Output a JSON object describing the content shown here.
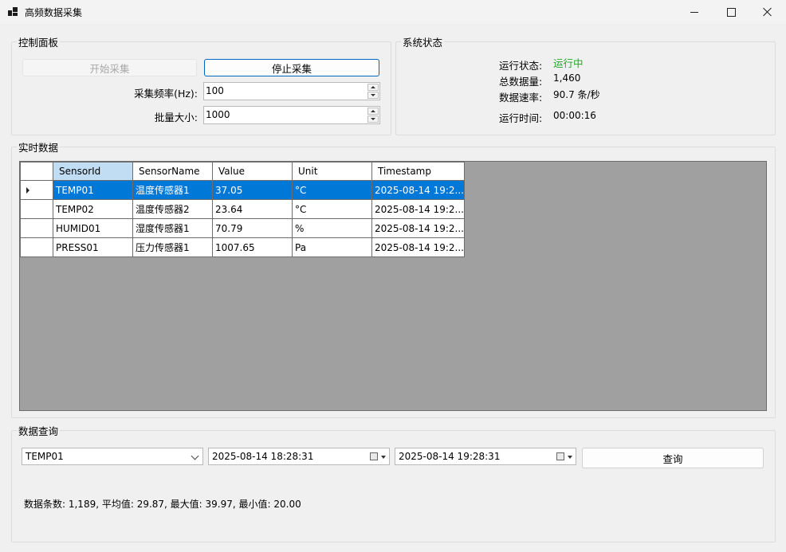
{
  "window": {
    "title": "高频数据采集"
  },
  "control": {
    "legend": "控制面板",
    "start_label": "开始采集",
    "stop_label": "停止采集",
    "freq_label": "采集频率(Hz):",
    "freq_value": "100",
    "batch_label": "批量大小:",
    "batch_value": "1000"
  },
  "status": {
    "legend": "系统状态",
    "run_state_label": "运行状态:",
    "run_state_value": "运行中",
    "run_state_color": "#22a52a",
    "total_label": "总数据量:",
    "total_value": "1,460",
    "rate_label": "数据速率:",
    "rate_value": "90.7 条/秒",
    "runtime_label": "运行时间:",
    "runtime_value": "00:00:16"
  },
  "realtime": {
    "legend": "实时数据",
    "columns": [
      "SensorId",
      "SensorName",
      "Value",
      "Unit",
      "Timestamp"
    ],
    "rows": [
      [
        "TEMP01",
        "温度传感器1",
        "37.05",
        "°C",
        "2025-08-14 19:2..."
      ],
      [
        "TEMP02",
        "温度传感器2",
        "23.64",
        "°C",
        "2025-08-14 19:2..."
      ],
      [
        "HUMID01",
        "湿度传感器1",
        "70.79",
        "%",
        "2025-08-14 19:2..."
      ],
      [
        "PRESS01",
        "压力传感器1",
        "1007.65",
        "Pa",
        "2025-08-14 19:2..."
      ]
    ]
  },
  "query": {
    "legend": "数据查询",
    "sensor_value": "TEMP01",
    "start_time": "2025-08-14 18:28:31",
    "end_time": "2025-08-14 19:28:31",
    "query_label": "查询",
    "result_text": "数据条数: 1,189, 平均值: 29.87, 最大值: 39.97, 最小值: 20.00"
  },
  "colors": {
    "accent": "#0078d7",
    "header_selected": "#c1ddf3",
    "grid_background": "#a0a0a0"
  }
}
